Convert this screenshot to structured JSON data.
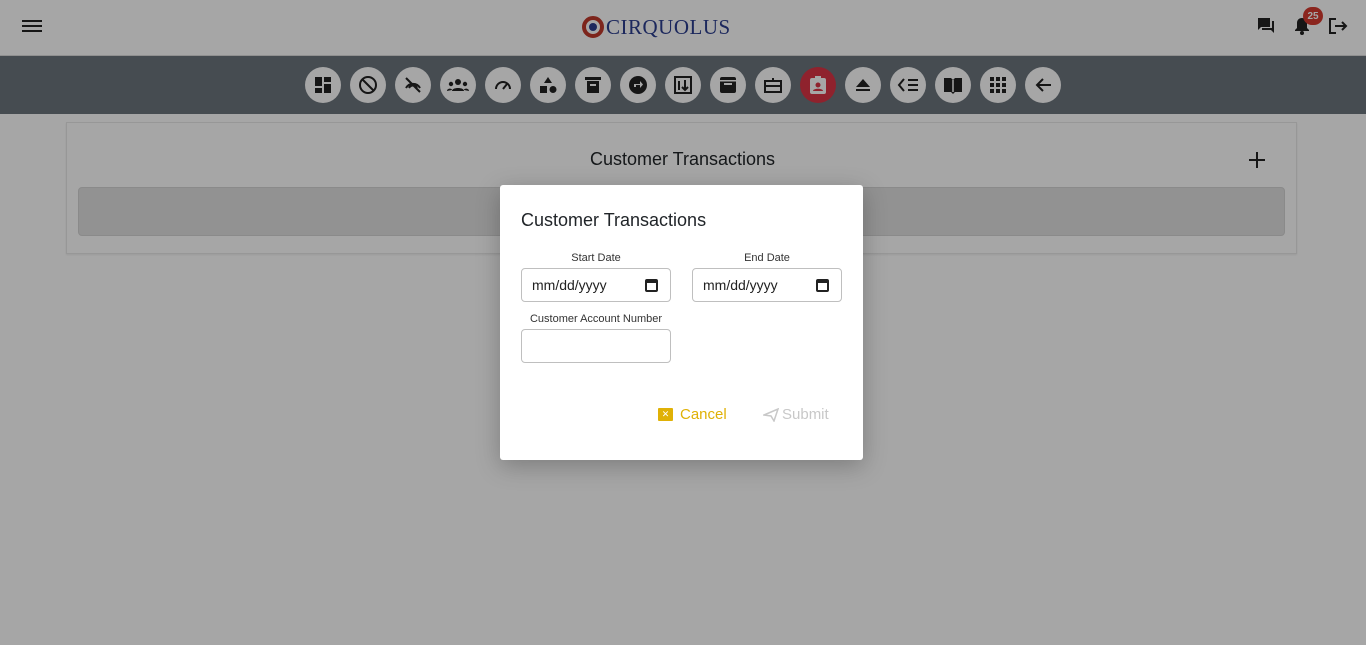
{
  "header": {
    "logo_text": "CIRQUOLUS",
    "notification_count": "25"
  },
  "toolbar": {
    "icons": [
      "dashboard-icon",
      "block-icon",
      "no-signal-icon",
      "groups-icon",
      "speed-icon",
      "shapes-icon",
      "archive-bin-icon",
      "directions-icon",
      "swap-icon",
      "archive-box-icon",
      "gift-card-icon",
      "contact-badge-icon",
      "eject-icon",
      "list-compare-icon",
      "book-icon",
      "apps-grid-icon",
      "back-arrow-icon"
    ],
    "active_index": 11
  },
  "page": {
    "title": "Customer Transactions"
  },
  "modal": {
    "title": "Customer Transactions",
    "start_date_label": "Start Date",
    "start_date_value": "mm/dd/yyyy",
    "end_date_label": "End Date",
    "end_date_value": "mm/dd/yyyy",
    "account_label": "Customer Account Number",
    "account_value": "",
    "cancel_label": "Cancel",
    "submit_label": "Submit"
  },
  "colors": {
    "toolbar_bg": "#6c757d",
    "active_btn": "#dc3545",
    "cancel": "#e0b106",
    "badge": "#d63a2f"
  }
}
